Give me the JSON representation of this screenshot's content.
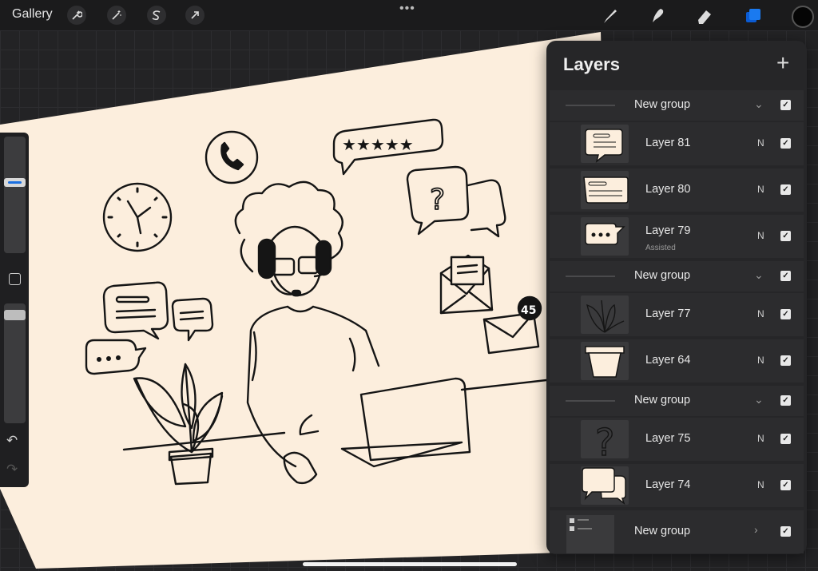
{
  "topbar": {
    "gallery_label": "Gallery",
    "tools_left": [
      "wrench-icon",
      "magic-wand-icon",
      "selection-s-icon",
      "arrow-transform-icon"
    ],
    "more_dots": "•••",
    "tools_right": [
      "brush-icon",
      "smudge-icon",
      "eraser-icon",
      "layers-icon"
    ],
    "active_color": "#050505",
    "accent": "#1a6fe0"
  },
  "canvas": {
    "paper_color": "#fceedd",
    "illustration": {
      "notification_count": "45"
    }
  },
  "sidebar": {
    "undo_icon": "↶",
    "redo_icon": "↷"
  },
  "layers": {
    "title": "Layers",
    "add_button": "+",
    "rows": [
      {
        "kind": "group",
        "name": "New group"
      },
      {
        "kind": "layer",
        "name": "Layer 81",
        "blend": "N"
      },
      {
        "kind": "layer",
        "name": "Layer 80",
        "blend": "N"
      },
      {
        "kind": "layer",
        "name": "Layer 79",
        "sub": "Assisted",
        "blend": "N"
      },
      {
        "kind": "group",
        "name": "New group"
      },
      {
        "kind": "layer",
        "name": "Layer 77",
        "blend": "N"
      },
      {
        "kind": "layer",
        "name": "Layer 64",
        "blend": "N"
      },
      {
        "kind": "group",
        "name": "New group"
      },
      {
        "kind": "layer",
        "name": "Layer 75",
        "blend": "N"
      },
      {
        "kind": "layer",
        "name": "Layer 74",
        "blend": "N"
      },
      {
        "kind": "group",
        "name": "New group"
      }
    ]
  }
}
